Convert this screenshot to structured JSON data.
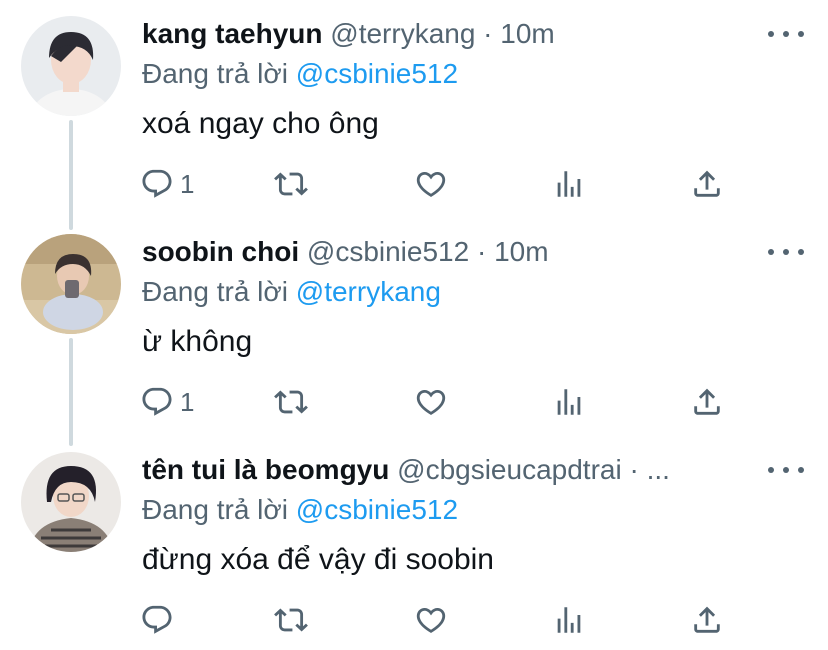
{
  "tweets": [
    {
      "name": "kang taehyun",
      "meta": "@terrykang · 10m",
      "replying_prefix": "Đang trả lời",
      "replying_to": "@csbinie512",
      "text": "xoá ngay cho ông",
      "reply_count": "1",
      "avatar_colors": {
        "bg": "#e9ecef",
        "hair": "#2b2b33",
        "skin": "#f3d9cc",
        "shirt": "#f5f5f5"
      }
    },
    {
      "name": "soobin choi",
      "meta": "@csbinie512 · 10m",
      "replying_prefix": "Đang trả lời",
      "replying_to": "@terrykang",
      "text": "ừ không",
      "reply_count": "1",
      "avatar_colors": {
        "bg": "#cdb892",
        "hair": "#3a3130",
        "skin": "#e8c9b3",
        "shirt": "#cfd6e4"
      }
    },
    {
      "name": "tên tui là beomgyu",
      "meta": "@cbgsieucapdtrai · ...",
      "replying_prefix": "Đang trả lời",
      "replying_to": "@csbinie512",
      "text": "đừng xóa để vậy đi soobin",
      "reply_count": "",
      "avatar_colors": {
        "bg": "#ece9e6",
        "hair": "#24202a",
        "skin": "#f1d7c8",
        "shirt": "#8a7f76"
      }
    }
  ],
  "icons": {
    "reply": "reply-icon",
    "retweet": "retweet-icon",
    "like": "heart-icon",
    "stats": "stats-icon",
    "share": "share-icon",
    "more": "more-icon"
  },
  "colors": {
    "text": "#0f1419",
    "secondary": "#536471",
    "link": "#1d9bf0",
    "thread_line": "#cfd9de"
  }
}
